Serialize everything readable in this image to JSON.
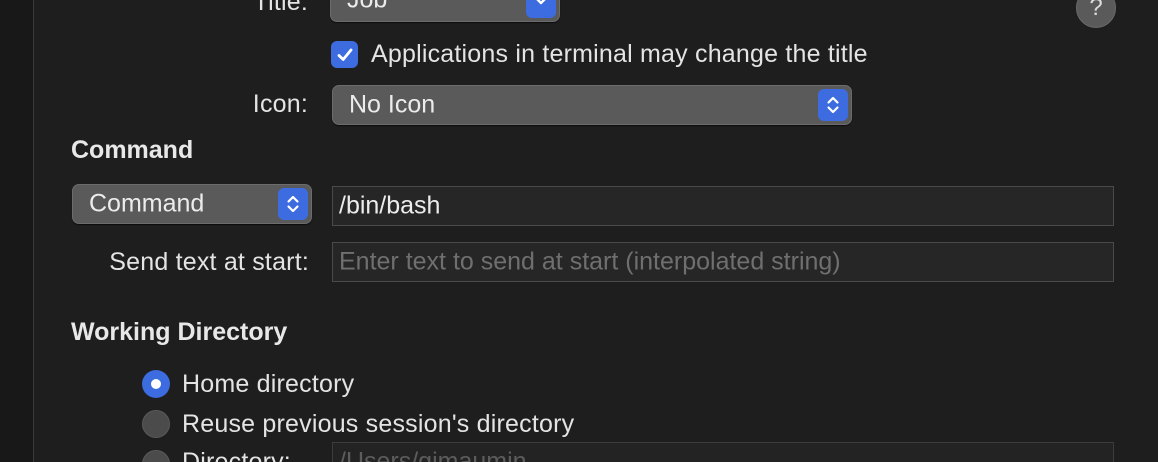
{
  "general": {
    "title_label": "Title:",
    "title_value": "Job",
    "apps_change_title_label": "Applications in terminal may change the title",
    "apps_change_title_checked": true,
    "icon_label": "Icon:",
    "icon_value": "No Icon",
    "help_glyph": "?"
  },
  "command": {
    "section_title": "Command",
    "mode_value": "Command",
    "command_value": "/bin/bash",
    "send_text_label": "Send text at start:",
    "send_text_placeholder": "Enter text to send at start (interpolated string)"
  },
  "working_directory": {
    "section_title": "Working Directory",
    "selected": "Home directory",
    "options": [
      {
        "label": "Home directory"
      },
      {
        "label": "Reuse previous session's directory"
      },
      {
        "label": "Directory:"
      }
    ],
    "directory_value": "/Users/gimaumin"
  },
  "colors": {
    "accent": "#3d6ce0",
    "background": "#1e1e1e"
  },
  "icons": {
    "stepper": "chevron-up-down-icon",
    "dropdown": "chevron-down-icon",
    "check": "checkmark-icon",
    "help": "question-mark-icon"
  }
}
